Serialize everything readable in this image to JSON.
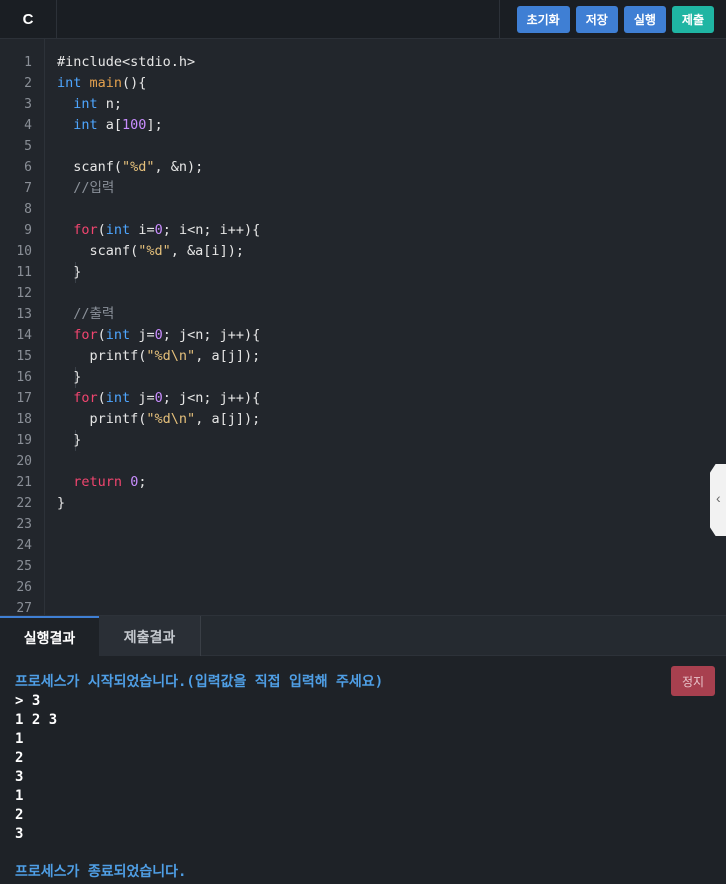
{
  "toolbar": {
    "language": "C",
    "reset_label": "초기화",
    "save_label": "저장",
    "run_label": "실행",
    "submit_label": "제출"
  },
  "editor": {
    "line_numbers": [
      "1",
      "2",
      "3",
      "4",
      "5",
      "6",
      "7",
      "8",
      "9",
      "10",
      "11",
      "12",
      "13",
      "14",
      "15",
      "16",
      "17",
      "18",
      "19",
      "20",
      "21",
      "22",
      "23",
      "24",
      "25",
      "26",
      "27"
    ],
    "code_lines": [
      "#include<stdio.h>",
      "int main(){",
      "  int n;",
      "  int a[100];",
      "",
      "  scanf(\"%d\", &n);",
      "  //입력",
      "",
      "  for(int i=0; i<n; i++){",
      "    scanf(\"%d\", &a[i]);",
      "  }",
      "",
      "  //출력",
      "  for(int j=0; j<n; j++){",
      "    printf(\"%d\\n\", a[j]);",
      "  }",
      "  for(int j=0; j<n; j++){",
      "    printf(\"%d\\n\", a[j]);",
      "  }",
      "",
      "  return 0;",
      "}"
    ]
  },
  "bottom_tabs": {
    "run_result": "실행결과",
    "submit_result": "제출결과"
  },
  "console": {
    "stop_label": "정지",
    "lines": [
      {
        "text": "프로세스가 시작되었습니다.(입력값을 직접 입력해 주세요)",
        "kind": "info"
      },
      {
        "text": "> 3",
        "kind": "out"
      },
      {
        "text": "1 2 3",
        "kind": "out"
      },
      {
        "text": "1",
        "kind": "out"
      },
      {
        "text": "2",
        "kind": "out"
      },
      {
        "text": "3",
        "kind": "out"
      },
      {
        "text": "1",
        "kind": "out"
      },
      {
        "text": "2",
        "kind": "out"
      },
      {
        "text": "3",
        "kind": "out"
      },
      {
        "text": "",
        "kind": "out"
      },
      {
        "text": "프로세스가 종료되었습니다.",
        "kind": "info"
      }
    ]
  },
  "colors": {
    "accent_blue": "#3f7fd4",
    "accent_teal": "#1fb5a3",
    "stop_red": "#a8404f",
    "info_text": "#4f9fe6"
  }
}
